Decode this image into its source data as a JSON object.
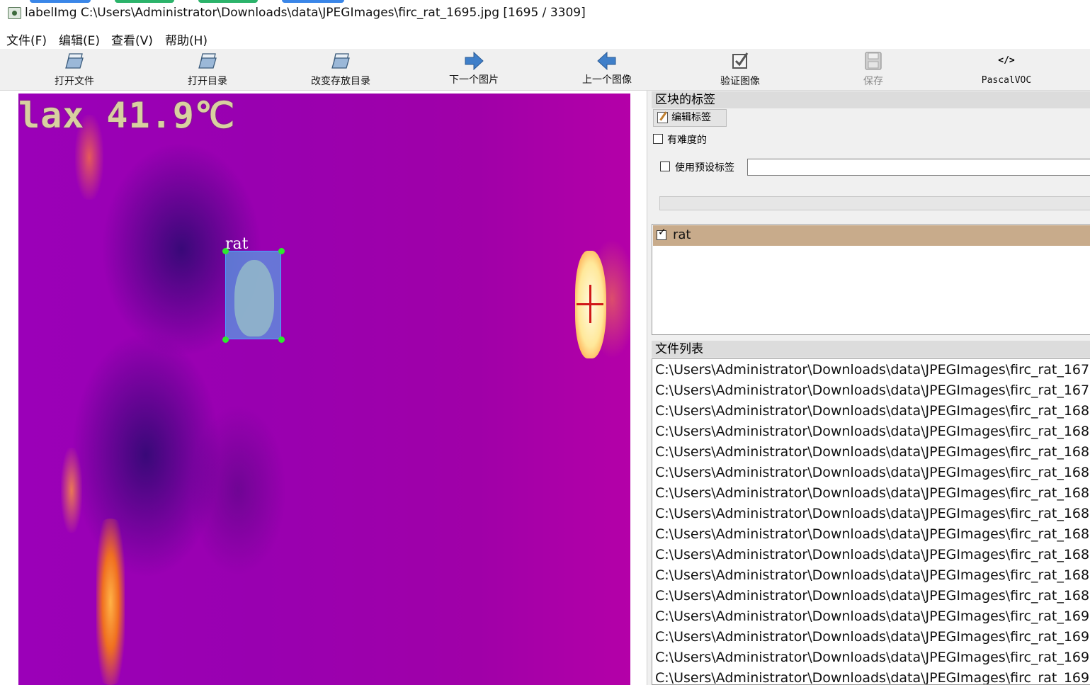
{
  "window": {
    "title": "labelImg C:\\Users\\Administrator\\Downloads\\data\\JPEGImages\\firc_rat_1695.jpg [1695 / 3309]"
  },
  "menu": {
    "file": "文件(F)",
    "edit": "编辑(E)",
    "view": "查看(V)",
    "help": "帮助(H)"
  },
  "toolbar": {
    "open_file": "打开文件",
    "open_dir": "打开目录",
    "change_save_dir": "改变存放目录",
    "next_image": "下一个图片",
    "prev_image": "上一个图像",
    "verify_image": "验证图像",
    "save": "保存",
    "format": "PascalVOC",
    "format_icon_glyph": "</>",
    "icons": {
      "open_file": "folder-open-icon",
      "open_dir": "folder-open-icon",
      "change_save_dir": "folder-open-icon",
      "next_image": "arrow-right-icon",
      "prev_image": "arrow-left-icon",
      "verify_image": "checkbox-check-icon",
      "save": "floppy-disk-icon",
      "format": "code-icon"
    }
  },
  "canvas": {
    "overlay_text": "lax 41.9℃",
    "annotation": {
      "label": "rat",
      "color": "#5a96e1"
    }
  },
  "box_labels_panel": {
    "title": "区块的标签",
    "edit_label_button": "编辑标签",
    "difficult_label": "有难度的",
    "difficult_checked": false,
    "use_default_label": "使用预设标签",
    "use_default_checked": false,
    "default_label_value": "",
    "labels": [
      {
        "text": "rat",
        "checked": true,
        "checkmark": "✓"
      }
    ]
  },
  "file_list_panel": {
    "title": "文件列表",
    "files": [
      "C:\\Users\\Administrator\\Downloads\\data\\JPEGImages\\firc_rat_167",
      "C:\\Users\\Administrator\\Downloads\\data\\JPEGImages\\firc_rat_167",
      "C:\\Users\\Administrator\\Downloads\\data\\JPEGImages\\firc_rat_168",
      "C:\\Users\\Administrator\\Downloads\\data\\JPEGImages\\firc_rat_168",
      "C:\\Users\\Administrator\\Downloads\\data\\JPEGImages\\firc_rat_168",
      "C:\\Users\\Administrator\\Downloads\\data\\JPEGImages\\firc_rat_168",
      "C:\\Users\\Administrator\\Downloads\\data\\JPEGImages\\firc_rat_168",
      "C:\\Users\\Administrator\\Downloads\\data\\JPEGImages\\firc_rat_168",
      "C:\\Users\\Administrator\\Downloads\\data\\JPEGImages\\firc_rat_168",
      "C:\\Users\\Administrator\\Downloads\\data\\JPEGImages\\firc_rat_168",
      "C:\\Users\\Administrator\\Downloads\\data\\JPEGImages\\firc_rat_168",
      "C:\\Users\\Administrator\\Downloads\\data\\JPEGImages\\firc_rat_168",
      "C:\\Users\\Administrator\\Downloads\\data\\JPEGImages\\firc_rat_169",
      "C:\\Users\\Administrator\\Downloads\\data\\JPEGImages\\firc_rat_169",
      "C:\\Users\\Administrator\\Downloads\\data\\JPEGImages\\firc_rat_169",
      "C:\\Users\\Administrator\\Downloads\\data\\JPEGImages\\firc_rat_169"
    ]
  },
  "colors": {
    "label_row_selected": "#c8ab8b",
    "handle": "#2ee82e",
    "tool_arrow": "#3f7fc9"
  }
}
